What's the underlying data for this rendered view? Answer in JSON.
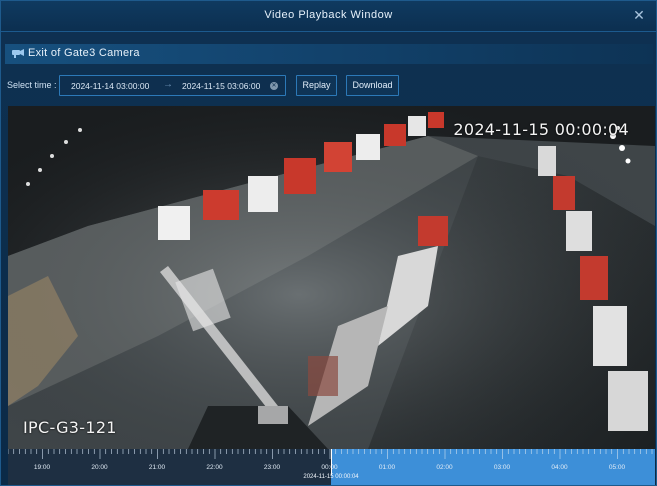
{
  "window": {
    "title": "Video Playback Window",
    "close_icon": "close-icon"
  },
  "section": {
    "title": "Exit of Gate3 Camera",
    "icon": "camera-icon"
  },
  "filter": {
    "label": "Select time :",
    "start": "2024-11-14 03:00:00",
    "arrow": "→",
    "end": "2024-11-15 03:06:00",
    "clear_icon": "clear-icon",
    "replay_label": "Replay",
    "download_label": "Download"
  },
  "video": {
    "timestamp": "2024-11-15 00:00:04",
    "camera_id": "IPC-G3-121"
  },
  "timeline": {
    "labels": [
      "19:00",
      "20:00",
      "21:00",
      "22:00",
      "23:00",
      "00:00",
      "01:00",
      "02:00",
      "03:00",
      "04:00",
      "05:00"
    ],
    "current": "2024-11-15 00:00:04"
  },
  "colors": {
    "accent": "#2c79b8",
    "timeline_future": "#3d8fd8",
    "background": "#0b2a47"
  }
}
